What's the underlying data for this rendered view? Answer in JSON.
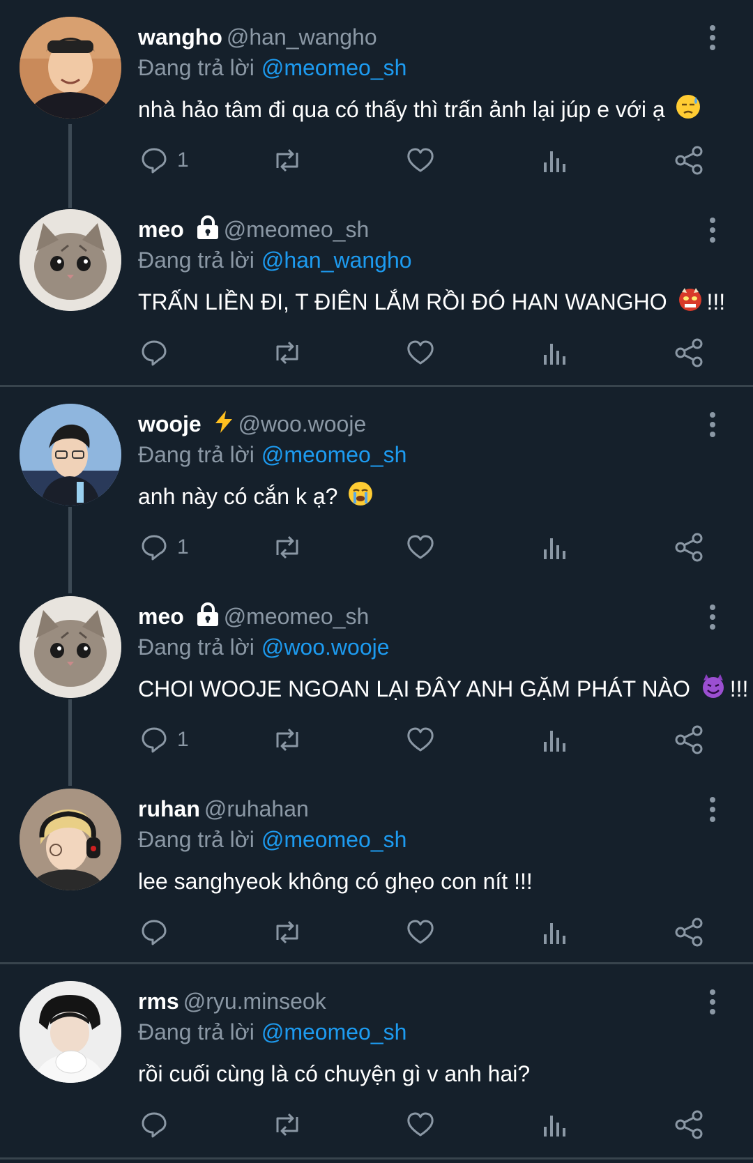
{
  "colors": {
    "background": "#15202b",
    "separator": "#38444d",
    "muted": "#8b98a5",
    "link": "#1d9bf0",
    "text": "#ffffff"
  },
  "tweets": [
    {
      "name": "wangho",
      "handle": "@han_wangho",
      "badge": "",
      "reply_prefix": "Đang trả lời",
      "reply_to": "@meomeo_sh",
      "text": "nhà hảo tâm đi qua có thấy thì trấn ảnh lại júp e với ạ",
      "text_suffix": "",
      "emoji": "downcast-sweat-emoji",
      "reply_count": "1",
      "avatar": "person-avatar"
    },
    {
      "name": "meo",
      "handle": "@meomeo_sh",
      "badge": "lock-icon",
      "reply_prefix": "Đang trả lời",
      "reply_to": "@han_wangho",
      "text": "TRẤN LIỀN ĐI, T ĐIÊN LẮM RỒI ĐÓ HAN WANGHO",
      "text_suffix": "!!!",
      "emoji": "ogre-emoji",
      "reply_count": "",
      "avatar": "kitten-avatar"
    },
    {
      "name": "wooje",
      "handle": "@woo.wooje",
      "badge": "lightning-icon",
      "reply_prefix": "Đang trả lời",
      "reply_to": "@meomeo_sh",
      "text": "anh này có cắn k ạ?",
      "text_suffix": "",
      "emoji": "crying-emoji",
      "reply_count": "1",
      "avatar": "person-avatar"
    },
    {
      "name": "meo",
      "handle": "@meomeo_sh",
      "badge": "lock-icon",
      "reply_prefix": "Đang trả lời",
      "reply_to": "@woo.wooje",
      "text": "CHOI WOOJE NGOAN LẠI ĐÂY ANH GẶM PHÁT NÀO",
      "text_suffix": "!!!",
      "emoji": "smiling-devil-emoji",
      "reply_count": "1",
      "avatar": "kitten-avatar"
    },
    {
      "name": "ruhan",
      "handle": "@ruhahan",
      "badge": "",
      "reply_prefix": "Đang trả lời",
      "reply_to": "@meomeo_sh",
      "text": "lee sanghyeok không có ghẹo con nít !!!",
      "text_suffix": "",
      "emoji": "",
      "reply_count": "",
      "avatar": "person-avatar"
    },
    {
      "name": "rms",
      "handle": "@ryu.minseok",
      "badge": "",
      "reply_prefix": "Đang trả lời",
      "reply_to": "@meomeo_sh",
      "text": "rồi cuối cùng là có chuyện gì v anh hai?",
      "text_suffix": "",
      "emoji": "",
      "reply_count": "",
      "avatar": "person-avatar"
    }
  ]
}
